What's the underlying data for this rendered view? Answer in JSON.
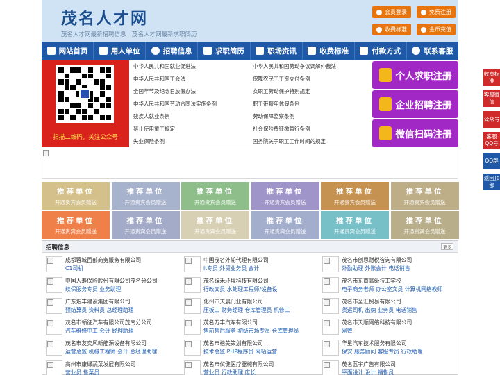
{
  "header": {
    "logo": "茂名人才网",
    "slogan": "茂名人才网最新招聘信息　茂名人才网最新求职简历",
    "buttons": [
      "会员登录",
      "免费注册",
      "收费标准",
      "金币充值"
    ]
  },
  "nav": [
    "网站首页",
    "用人单位",
    "招聘信息",
    "求职简历",
    "职场资讯",
    "收费标准",
    "付款方式",
    "联系客服"
  ],
  "qr": {
    "caption": "扫描二维码，关注公众号"
  },
  "links": {
    "left": [
      "中华人民共和国就业促进法",
      "中华人民共和国工会法",
      "全国年节及纪念日放假办法",
      "中华人民共和国劳动合同法实施条例",
      "残疾人就业条例",
      "禁止使用童工规定",
      "失业保险条例"
    ],
    "right": [
      "中华人民共和国劳动争议调解仲裁法",
      "保障农民工工资支付条例",
      "女职工劳动保护特别规定",
      "职工带薪年休假条例",
      "劳动保障监察条例",
      "社会保险费征缴暂行条例",
      "国务院关于职工工作时间的规定"
    ]
  },
  "register": [
    "个人求职注册",
    "企业招聘注册",
    "微信扫码注册"
  ],
  "recommend": {
    "title": "推荐单位",
    "subtitle": "开通贵宾会员赠送",
    "colors": [
      "#d3c08a",
      "#a7b2cc",
      "#8ebf8a",
      "#a095c8",
      "#c69252",
      "#bdae88",
      "#f0804a",
      "#a4abc8",
      "#d8d0b4",
      "#a3adcc",
      "#78c0c8",
      "#b9ae8a"
    ]
  },
  "jobs": {
    "title": "招聘信息",
    "more": "更多",
    "rows": [
      [
        {
          "company": "成都蓉城西部商务服务有限公司",
          "positions": "C1司机"
        },
        {
          "company": "中国茂名外轮代理有限公司",
          "positions": "it专员 外贸业务员 会计"
        },
        {
          "company": "茂名市创思财税咨询有限公司",
          "positions": "外勤助理 外账会计 电话销售"
        }
      ],
      [
        {
          "company": "中国人寿保险股份有限公司茂名分公司",
          "positions": "续保服务专员 业务助理"
        },
        {
          "company": "茂名绿禾环境科技有限公司",
          "positions": "行政文员 水处理工程师/设备设"
        },
        {
          "company": "茂名市东南高级技工学校",
          "positions": "电子商务老师 办公室文员 计算机网络教师"
        }
      ],
      [
        {
          "company": "广东煜丰建设集团有限公司",
          "positions": "预结算员 资料员 总经理助理"
        },
        {
          "company": "化州市天晨门业有限公司",
          "positions": "压板工 财务经理 仓库管理员 机修工"
        },
        {
          "company": "茂名市至汇贸易有限公司",
          "positions": "货运司机 出纳 业务员 电话销售"
        }
      ],
      [
        {
          "company": "茂名市领征汽车有限公司茂南分公司",
          "positions": "汽车维修中工 会计 经理助理"
        },
        {
          "company": "茂名万丰汽车有限公司",
          "positions": "售前售后服务 初级市场专员 仓库管理员"
        },
        {
          "company": "茂名市天顺网络科技有限公司",
          "positions": "网管"
        }
      ],
      [
        {
          "company": "茂名市友奕风新能源设备有限公司",
          "positions": "运营总监 机械工程师 会计 总经理助理"
        },
        {
          "company": "茂名市楷美策划有限公司",
          "positions": "技术总监 PHP程序员 网站运营"
        },
        {
          "company": "华星汽车技术服务有限公司",
          "positions": "保安 服务顾问 客服专员 行政助理"
        }
      ],
      [
        {
          "company": "高州市康绿蔬菜发展有限公司",
          "positions": "营业员 售菜员"
        },
        {
          "company": "茂名市仪健医疗器械有限公司",
          "positions": "营业员 行政助理 店长"
        },
        {
          "company": "茂名蓝宇广告有限公司",
          "positions": "平面设计 设计 销售员"
        }
      ]
    ]
  },
  "float": [
    "收费标准",
    "客服微信",
    "公众号",
    "客服QQ号",
    "QQ群",
    "返回顶部"
  ]
}
